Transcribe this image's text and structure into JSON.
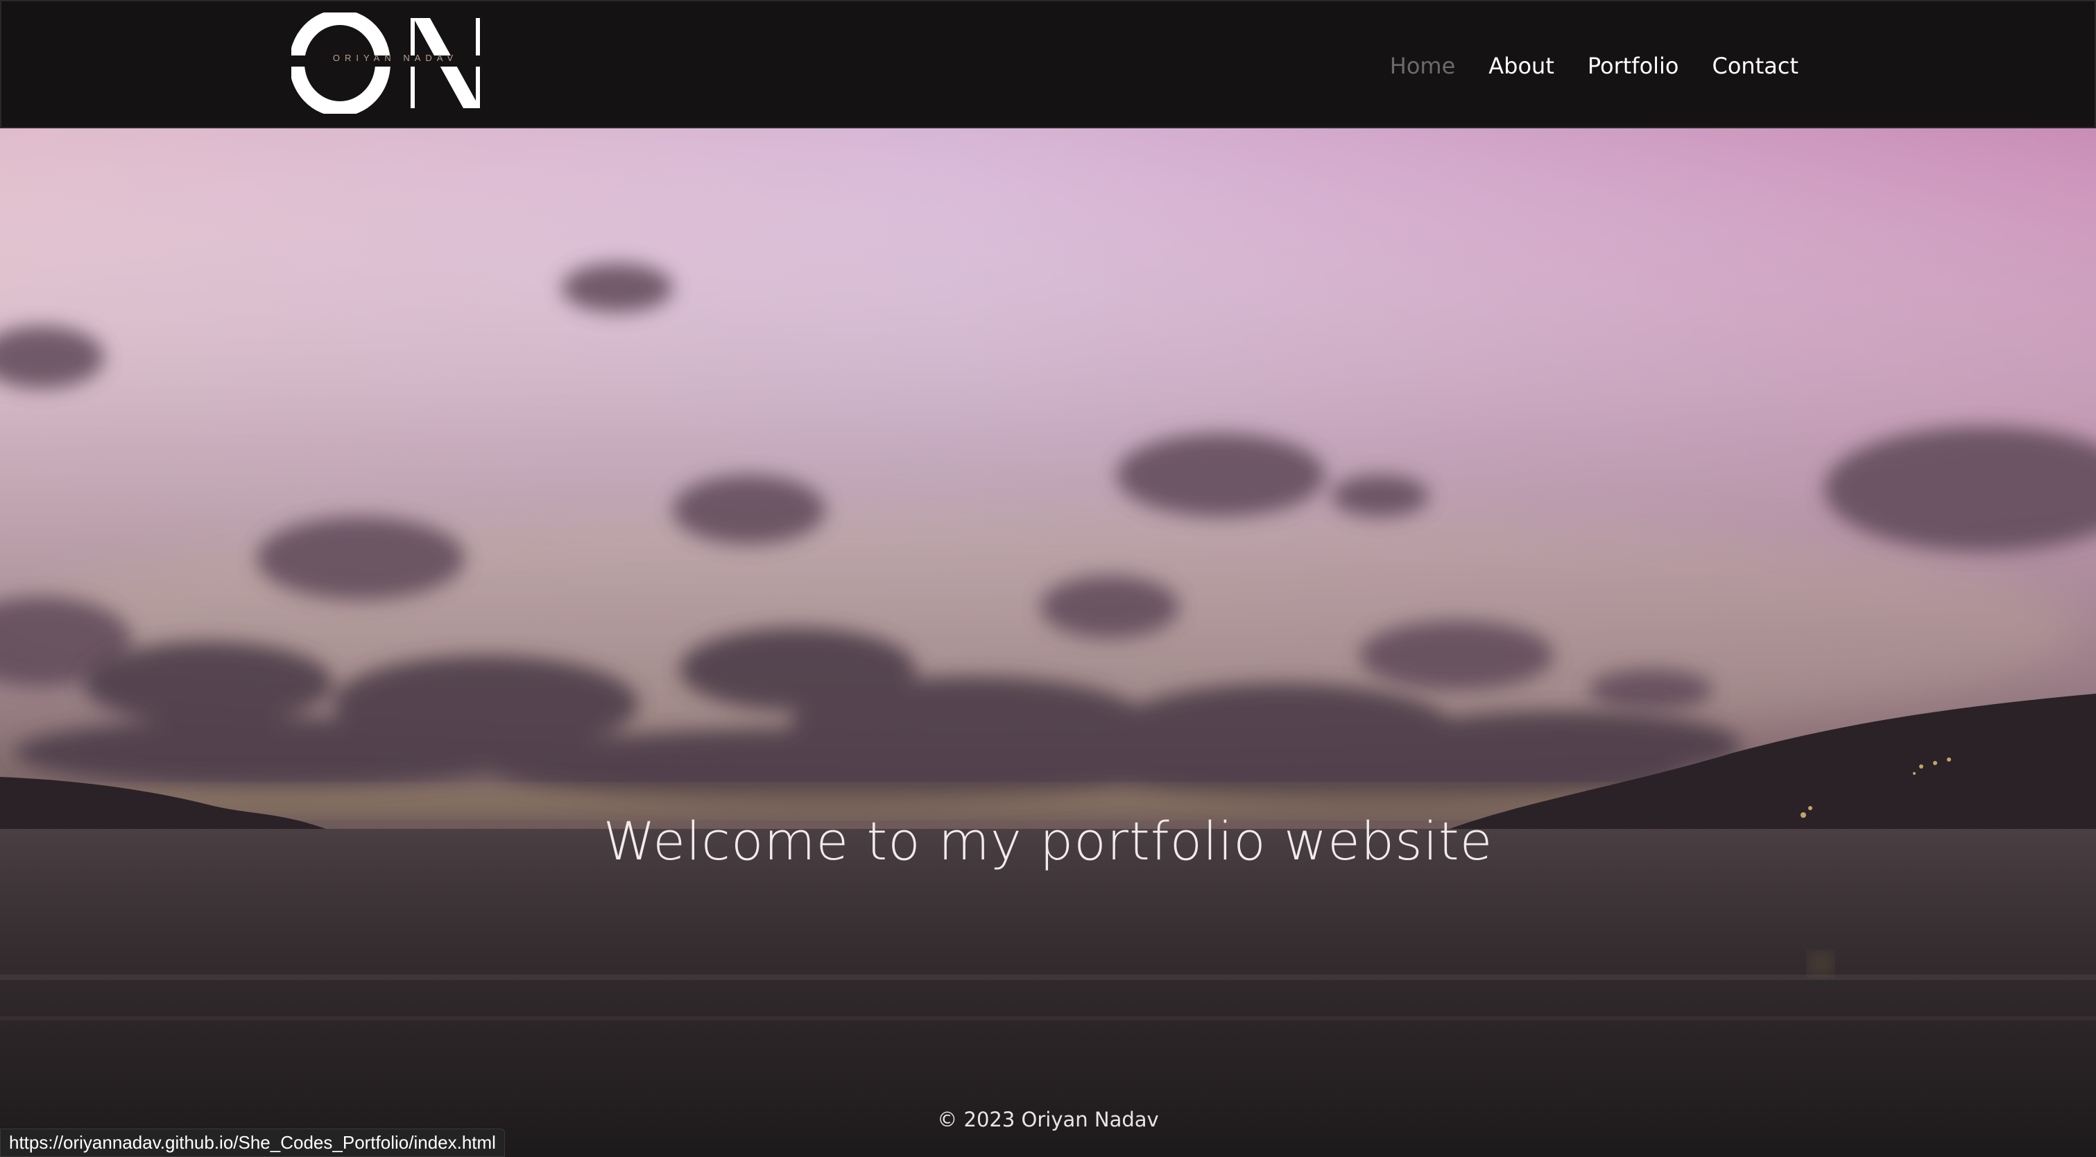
{
  "logo": {
    "monogram": "ON",
    "subtitle": "ORIYAN NADAV"
  },
  "nav": {
    "items": [
      {
        "label": "Home",
        "active": true
      },
      {
        "label": "About",
        "active": false
      },
      {
        "label": "Portfolio",
        "active": false
      },
      {
        "label": "Contact",
        "active": false
      }
    ]
  },
  "hero": {
    "title": "Welcome to my portfolio website"
  },
  "footer": {
    "copyright": "© 2023 Oriyan Nadav"
  },
  "status_bar": {
    "url": "https://oriyannadav.github.io/She_Codes_Portfolio/index.html"
  },
  "colors": {
    "navbar_bg": "#141213",
    "nav_active": "#6c6a6b",
    "nav_text": "#ffffff",
    "sky_top": "#d9b6d4",
    "sky_mid": "#b9a3b5",
    "sea": "#3a3134"
  }
}
